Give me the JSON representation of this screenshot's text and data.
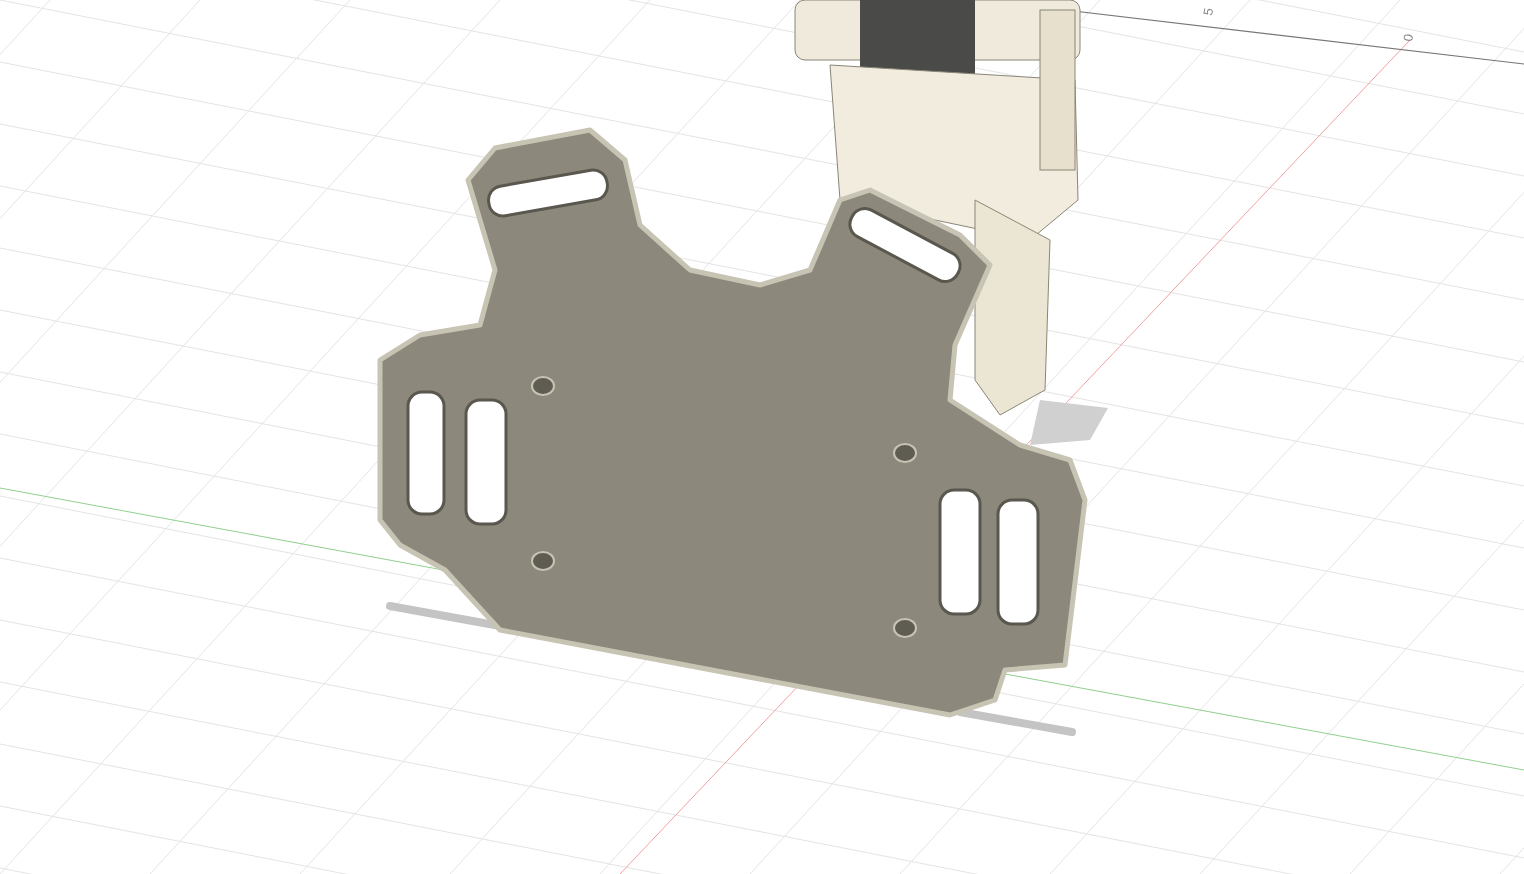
{
  "viewport": {
    "axis_labels": [
      "5",
      "0"
    ]
  }
}
